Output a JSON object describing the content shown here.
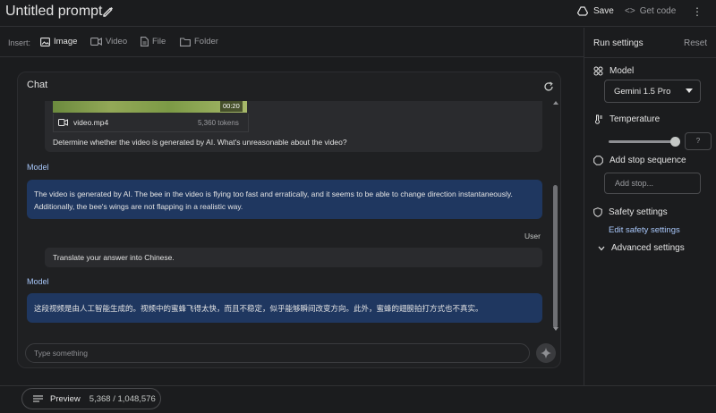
{
  "header": {
    "title": "Untitled prompt",
    "save_label": "Save",
    "get_code_label": "Get code"
  },
  "insert_bar": {
    "label": "Insert:",
    "items": [
      {
        "label": "Image",
        "icon": "image-icon"
      },
      {
        "label": "Video",
        "icon": "video-icon"
      },
      {
        "label": "File",
        "icon": "file-icon"
      },
      {
        "label": "Folder",
        "icon": "folder-icon"
      }
    ]
  },
  "chat": {
    "title": "Chat",
    "video_attachment": {
      "duration": "00:20",
      "filename": "video.mp4",
      "tokens": "5,360 tokens"
    },
    "messages": [
      {
        "role": "User",
        "text": "Determine whether the video is generated by AI. What's unreasonable about the video?"
      },
      {
        "role": "Model",
        "text": "The video is generated by AI. The bee in the video is flying too fast and erratically, and it seems to be able to change direction instantaneously. Additionally, the bee's wings are not flapping in a realistic way."
      },
      {
        "role": "User",
        "text": "Translate your answer into Chinese."
      },
      {
        "role": "Model",
        "text": "这段视频是由人工智能生成的。视频中的蜜蜂飞得太快，而且不稳定，似乎能够瞬间改变方向。此外，蜜蜂的翅膀拍打方式也不真实。"
      }
    ],
    "compose_placeholder": "Type something"
  },
  "run_settings": {
    "title": "Run settings",
    "reset_label": "Reset",
    "model_label": "Model",
    "model_value": "Gemini 1.5 Pro",
    "temperature_label": "Temperature",
    "temperature_value": "?",
    "temperature_level": 1.0,
    "stop_sequence_label": "Add stop sequence",
    "stop_placeholder": "Add stop...",
    "safety_label": "Safety settings",
    "safety_link": "Edit safety settings",
    "advanced_label": "Advanced settings"
  },
  "footer": {
    "preview_label": "Preview",
    "token_count": "5,368 / 1,048,576"
  },
  "colors": {
    "background": "#1b1c1e",
    "model_bubble": "#1f3760",
    "user_bubble": "#2a2b2e",
    "accent_link": "#a8c7fa"
  }
}
